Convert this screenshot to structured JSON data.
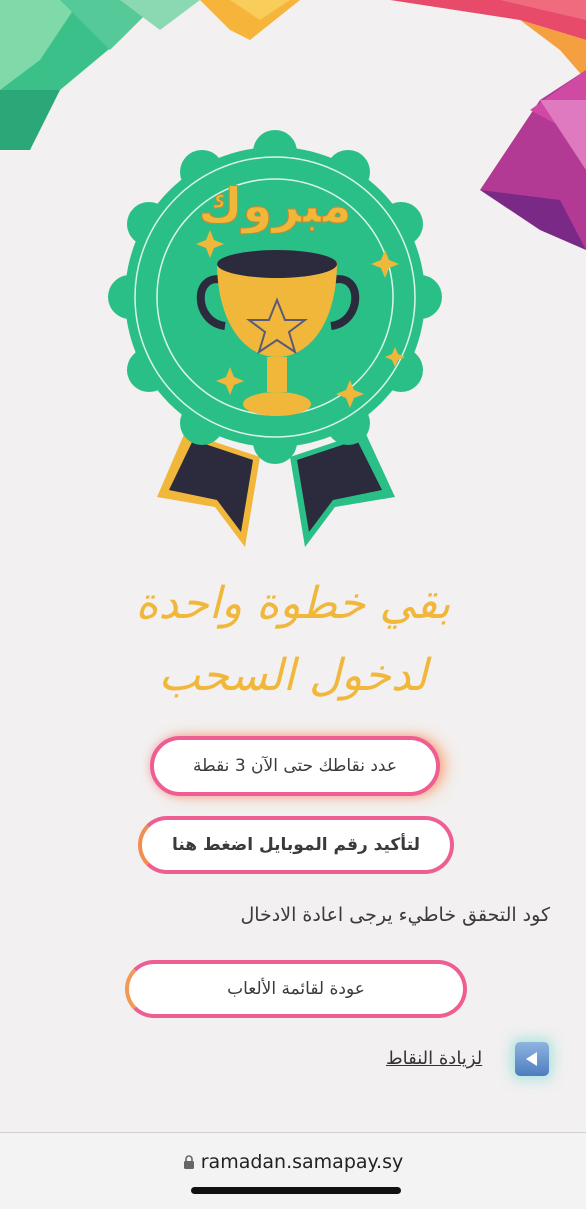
{
  "badge": {
    "title": "مبروك"
  },
  "headline": {
    "line1": "بقي خطوة واحدة",
    "line2": "لدخول السحب"
  },
  "points_button": {
    "label": "عدد نقاطك حتى الآن 3 نقطة"
  },
  "confirm_button": {
    "label": "لتأكيد رقم الموبايل اضغط هنا"
  },
  "error_message": "كود التحقق خاطيء يرجى اعادة الادخال",
  "back_button": {
    "label": "عودة لقائمة الألعاب"
  },
  "more_points_link": {
    "label": "لزيادة النقاط"
  },
  "browser": {
    "url": "ramadan.samapay.sy"
  },
  "colors": {
    "badge_green": "#2bbf88",
    "gold": "#f0b73b",
    "pink": "#ee5e93",
    "orange": "#f28e52"
  }
}
